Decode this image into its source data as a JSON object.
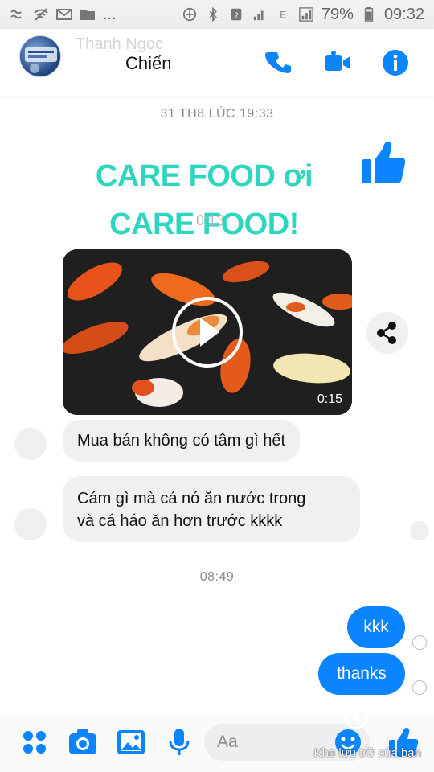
{
  "status_bar": {
    "ellipsis": "...",
    "battery": "79%",
    "time": "09:32"
  },
  "header": {
    "contact_name_line1": "Thanh Ngoc",
    "title": "Chiến",
    "icons": [
      "phone-icon",
      "video-call-icon",
      "info-icon"
    ]
  },
  "chat": {
    "date_separator_1": "31 TH8 LÚC 19:33",
    "promo_line1": "CARE FOOD ơi",
    "promo_line2": "CARE FOOD!",
    "overlay_time": "0:13",
    "video": {
      "duration": "0:15"
    },
    "messages_in": [
      {
        "text": "Mua bán không có tâm gì hết"
      },
      {
        "text_line1": "Cám gì mà cá nó ăn nước trong",
        "text_line2": "và cá háo ăn hơn trước kkkk"
      }
    ],
    "date_separator_2": "08:49",
    "messages_out": [
      {
        "text": "kkk"
      },
      {
        "text": "thanks"
      }
    ]
  },
  "composer": {
    "placeholder": "Aa",
    "icons": [
      "apps-icon",
      "camera-icon",
      "gallery-icon",
      "mic-icon",
      "emoji-icon",
      "like-icon"
    ]
  },
  "watermark": "Kho lưu trữ của bạn",
  "colors": {
    "accent": "#0a84ff",
    "promo_text": "#2ed6c0",
    "incoming_bubble": "#f0f0f0"
  }
}
